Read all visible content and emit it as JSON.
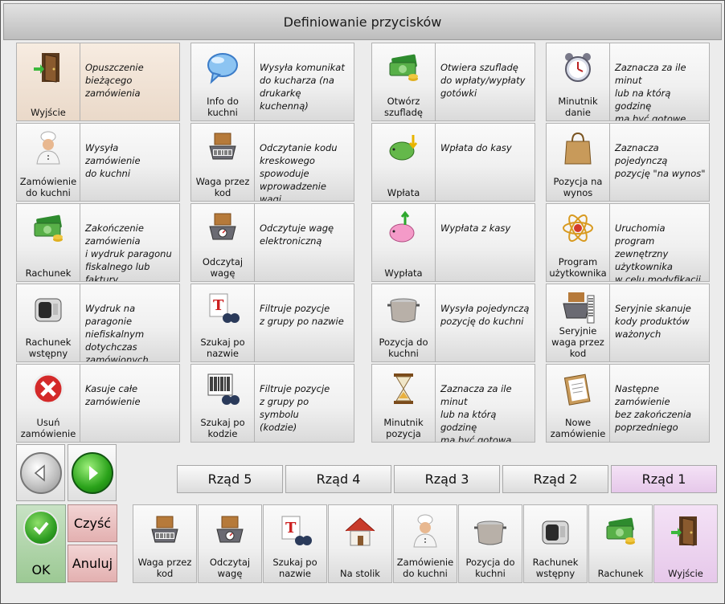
{
  "title": "Definiowanie przycisków",
  "grid": [
    [
      {
        "label": "Wyjście",
        "desc": "Opuszczenie\nbieżącego\nzamówienia",
        "icon": "door-exit-icon",
        "sel": true
      },
      {
        "label": "Info do\nkuchni",
        "desc": "Wysyła komunikat\ndo kucharza (na drukarkę\nkuchenną)",
        "icon": "speech-bubble-icon"
      },
      {
        "label": "Otwórz\nszufladę",
        "desc": "Otwiera szufladę\ndo wpłaty/wypłaty\ngotówki",
        "icon": "money-icon"
      },
      {
        "label": "Minutnik\ndanie",
        "desc": "Zaznacza za ile minut\nlub na którą godzinę\nma być gotowe\ncałe danie",
        "icon": "alarm-clock-icon"
      }
    ],
    [
      {
        "label": "Zamówienie\ndo kuchni",
        "desc": "Wysyła\nzamówienie\ndo kuchni",
        "icon": "chef-icon"
      },
      {
        "label": "Waga przez\nkod",
        "desc": "Odczytanie kodu\nkreskowego spowoduje\nwprowadzenie wagi\n(ilości)",
        "icon": "scale-barcode-icon"
      },
      {
        "label": "Wpłata",
        "desc": "Wpłata do kasy",
        "icon": "piggy-deposit-icon"
      },
      {
        "label": "Pozycja na\nwynos",
        "desc": "Zaznacza pojedynczą\npozycję \"na wynos\"",
        "icon": "paper-bag-icon"
      }
    ],
    [
      {
        "label": "Rachunek",
        "desc": "Zakończenie\nzamówienia\ni wydruk paragonu\nfiskalnego lub faktury",
        "icon": "money-icon"
      },
      {
        "label": "Odczytaj\nwagę",
        "desc": "Odczytuje wagę\nelektroniczną",
        "icon": "scale-icon"
      },
      {
        "label": "Wypłata",
        "desc": "Wypłata z kasy",
        "icon": "piggy-withdraw-icon"
      },
      {
        "label": "Program\nużytkownika",
        "desc": "Uruchomia program\nzewnętrzny\nużytkownika\nw celu modyfikacji\nzamówienia",
        "icon": "atom-icon"
      }
    ],
    [
      {
        "label": "Rachunek\nwstępny",
        "desc": "Wydruk na paragonie\nniefiskalnym\ndotychczas\nzamówionych pozycji",
        "icon": "receipt-printer-icon"
      },
      {
        "label": "Szukaj po\nnazwie",
        "desc": "Filtruje pozycje\nz grupy po nazwie",
        "icon": "search-name-icon"
      },
      {
        "label": "Pozycja do\nkuchni",
        "desc": "Wysyła pojedynczą\npozycję do kuchni",
        "icon": "cooking-pot-icon"
      },
      {
        "label": "Seryjnie\nwaga przez\nkod",
        "desc": "Seryjnie skanuje\nkody produktów\nważonych",
        "icon": "scale-barcode-series-icon"
      }
    ],
    [
      {
        "label": "Usuń\nzamówienie",
        "desc": "Kasuje całe\nzamówienie",
        "icon": "delete-icon"
      },
      {
        "label": "Szukaj po\nkodzie",
        "desc": "Filtruje pozycje\nz grupy po symbolu\n(kodzie)",
        "icon": "search-barcode-icon"
      },
      {
        "label": "Minutnik\npozycja",
        "desc": "Zaznacza za ile minut\nlub na którą godzinę\nma być gotowa\npojedyncza\npozycja w daniu",
        "icon": "hourglass-icon"
      },
      {
        "label": "Nowe\nzamówienie",
        "desc": "Następne zamówienie\nbez zakończenia\npoprzedniego",
        "icon": "clipboard-icon"
      }
    ]
  ],
  "rows": [
    {
      "label": "Rząd 5"
    },
    {
      "label": "Rząd 4"
    },
    {
      "label": "Rząd 3"
    },
    {
      "label": "Rząd 2"
    },
    {
      "label": "Rząd 1",
      "sel": true
    }
  ],
  "ok_label": "OK",
  "clear_label": "Czyść",
  "cancel_label": "Anuluj",
  "bar": [
    {
      "label": "Waga przez\nkod",
      "icon": "scale-barcode-icon"
    },
    {
      "label": "Odczytaj\nwagę",
      "icon": "scale-icon"
    },
    {
      "label": "Szukaj po\nnazwie",
      "icon": "search-name-icon"
    },
    {
      "label": "Na stolik",
      "icon": "house-icon"
    },
    {
      "label": "Zamówienie\ndo kuchni",
      "icon": "chef-icon"
    },
    {
      "label": "Pozycja do\nkuchni",
      "icon": "cooking-pot-icon"
    },
    {
      "label": "Rachunek\nwstępny",
      "icon": "receipt-printer-icon"
    },
    {
      "label": "Rachunek",
      "icon": "money-icon"
    },
    {
      "label": "Wyjście",
      "icon": "door-exit-icon",
      "sel": true
    }
  ]
}
